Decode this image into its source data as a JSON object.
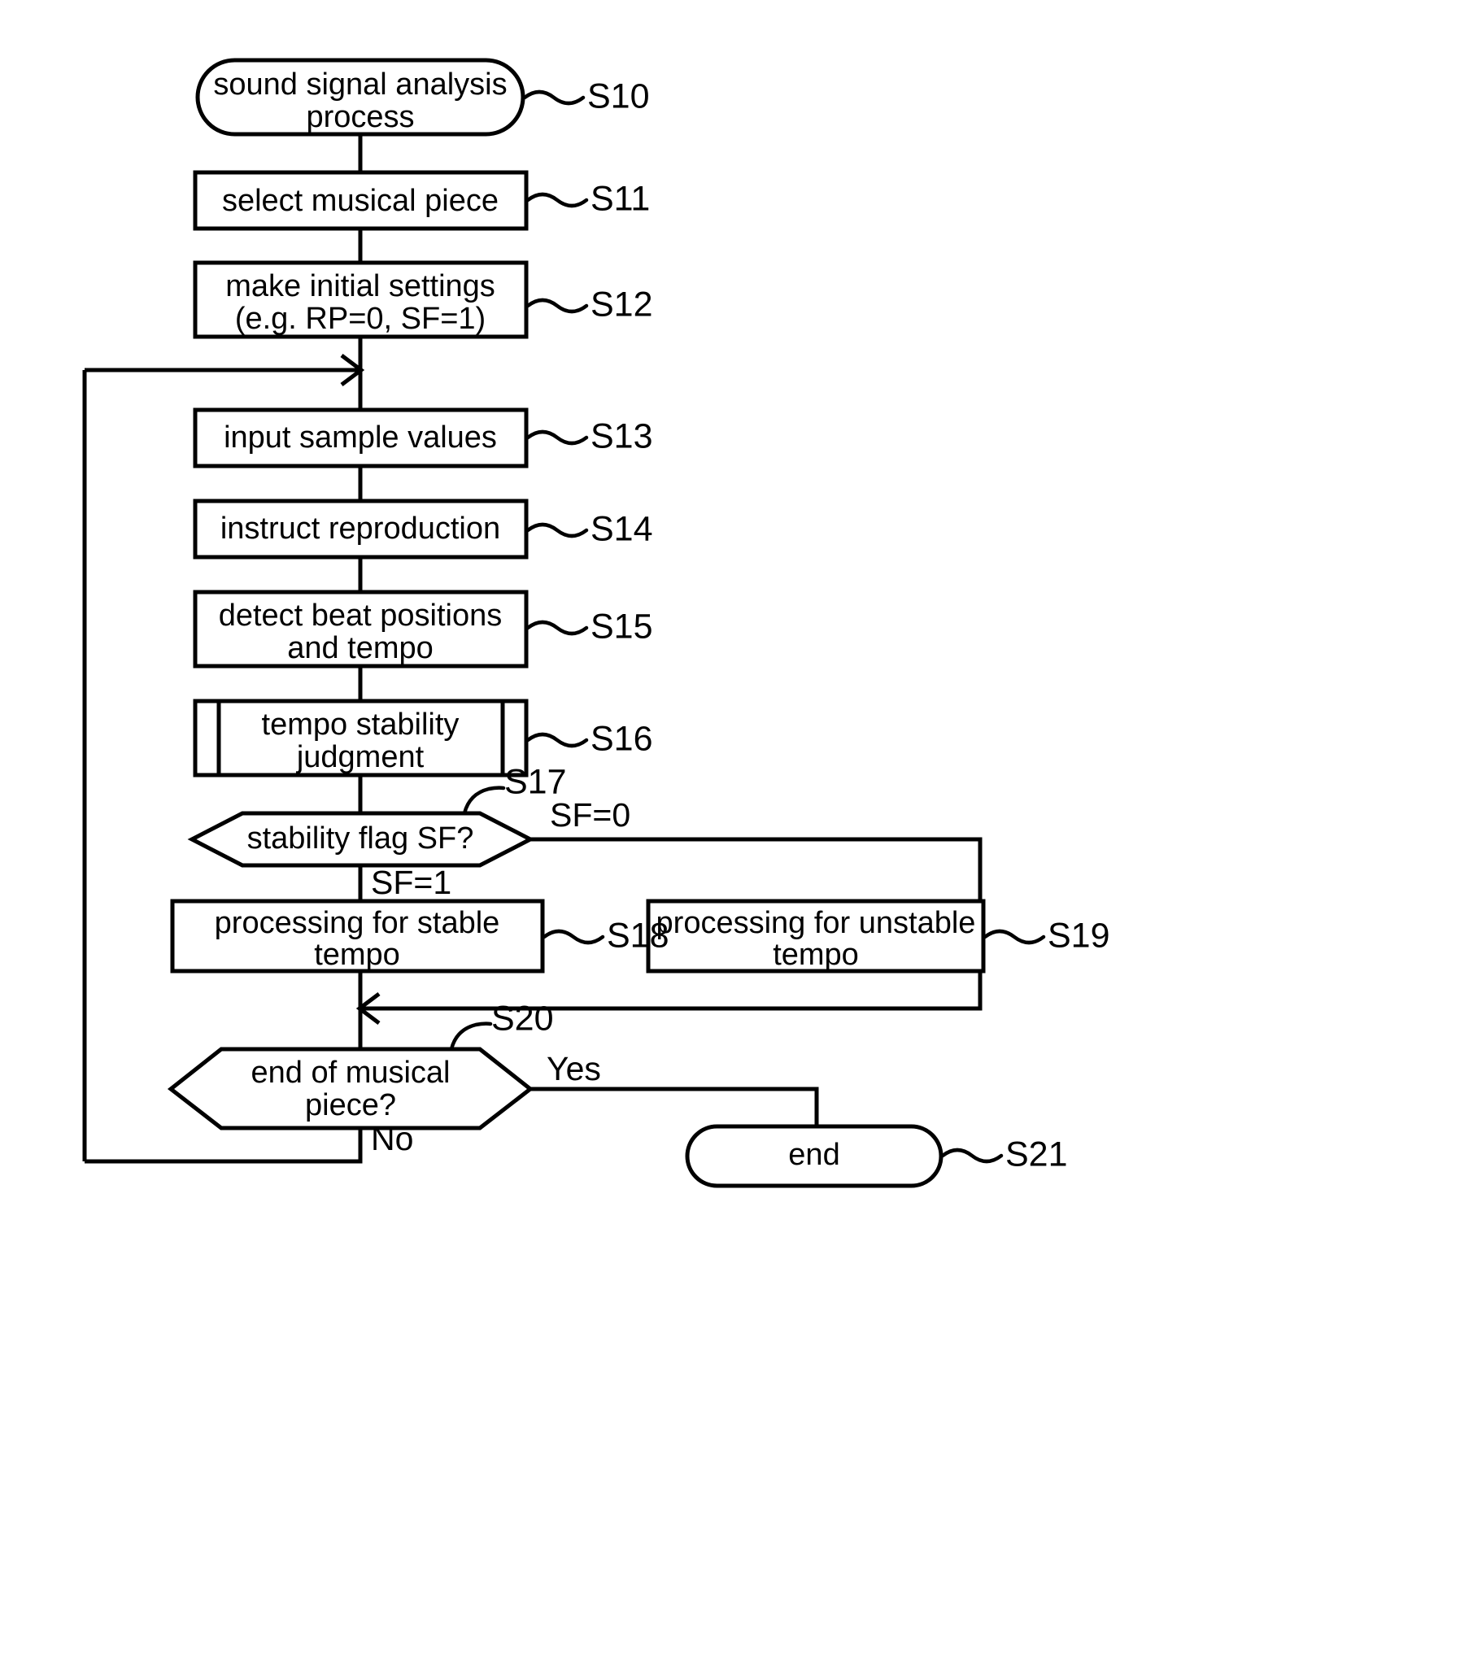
{
  "figure": {
    "type": "flowchart",
    "title": "sound signal analysis process",
    "orientation": "top-to-bottom"
  },
  "nodes": {
    "s10": {
      "shape": "terminator",
      "line1": "sound signal analysis",
      "line2": "process",
      "step": "S10"
    },
    "s11": {
      "shape": "process",
      "line1": "select musical piece",
      "line2": "",
      "step": "S11"
    },
    "s12": {
      "shape": "process",
      "line1": "make initial settings",
      "line2": "(e.g. RP=0, SF=1)",
      "step": "S12"
    },
    "s13": {
      "shape": "process",
      "line1": "input sample values",
      "line2": "",
      "step": "S13"
    },
    "s14": {
      "shape": "process",
      "line1": "instruct reproduction",
      "line2": "",
      "step": "S14"
    },
    "s15": {
      "shape": "process",
      "line1": "detect beat positions",
      "line2": "and tempo",
      "step": "S15"
    },
    "s16": {
      "shape": "predefined-process",
      "line1": "tempo stability",
      "line2": "judgment",
      "step": "S16"
    },
    "s17": {
      "shape": "decision-hexagon",
      "line1": "stability flag SF?",
      "line2": "",
      "step": "S17"
    },
    "s18": {
      "shape": "process",
      "line1": "processing for stable",
      "line2": "tempo",
      "step": "S18"
    },
    "s19": {
      "shape": "process",
      "line1": "processing for unstable",
      "line2": "tempo",
      "step": "S19"
    },
    "s20": {
      "shape": "decision-hexagon",
      "line1": "end of musical",
      "line2": "piece?",
      "step": "S20"
    },
    "s21": {
      "shape": "terminator",
      "line1": "end",
      "line2": "",
      "step": "S21"
    }
  },
  "edge_labels": {
    "sf_zero": "SF=0",
    "sf_one": "SF=1",
    "yes": "Yes",
    "no": "No"
  },
  "colors": {
    "stroke": "#000000",
    "fill": "#ffffff",
    "text": "#000000"
  }
}
